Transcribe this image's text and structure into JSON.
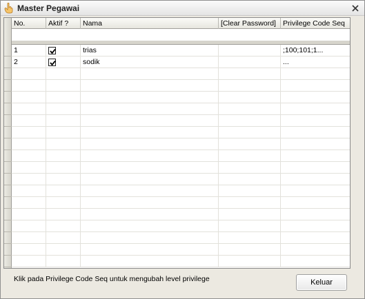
{
  "window": {
    "title": "Master Pegawai"
  },
  "grid": {
    "columns": [
      {
        "label": "No."
      },
      {
        "label": "Aktif ?"
      },
      {
        "label": "Nama"
      },
      {
        "label": "[Clear Password]"
      },
      {
        "label": "Privilege Code Seq"
      }
    ],
    "rows": [
      {
        "no": "1",
        "aktif": true,
        "nama": "trias",
        "clear_password": "",
        "privilege": ";100;101;1..."
      },
      {
        "no": "2",
        "aktif": true,
        "nama": "sodik",
        "clear_password": "",
        "privilege": "..."
      }
    ]
  },
  "footer": {
    "hint": "Klik pada Privilege Code Seq untuk mengubah level privilege",
    "keluar_label": "Keluar"
  },
  "icons": {
    "app": "hand-pointer-icon",
    "close": "close-icon",
    "check": "checkmark-icon"
  },
  "colors": {
    "window_bg": "#ece9e1",
    "grid_bg": "#ffffff",
    "header_bg": "#e7e6df"
  }
}
